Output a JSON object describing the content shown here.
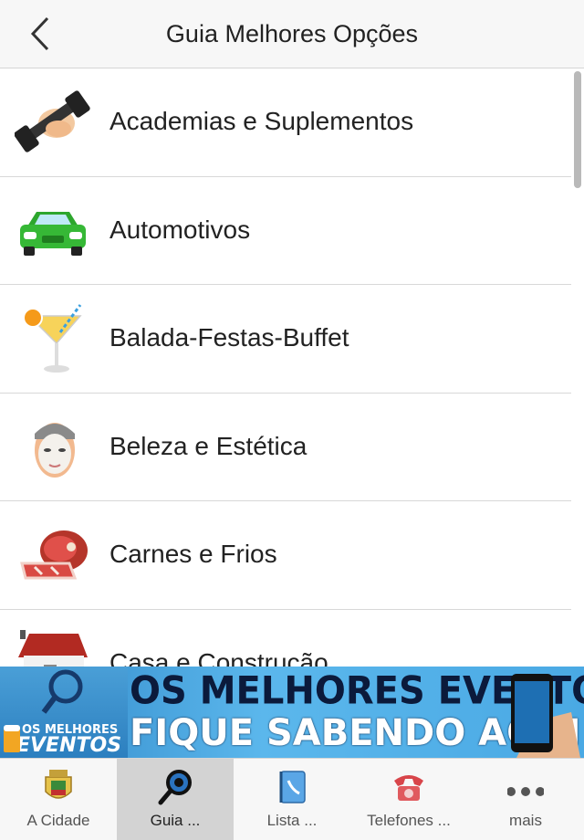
{
  "header": {
    "title": "Guia Melhores Opções",
    "back_icon": "chevron-left-icon"
  },
  "list": {
    "items": [
      {
        "label": "Academias e Suplementos",
        "icon": "dumbbell-icon"
      },
      {
        "label": "Automotivos",
        "icon": "car-icon"
      },
      {
        "label": "Balada-Festas-Buffet",
        "icon": "cocktail-icon"
      },
      {
        "label": "Beleza e Estética",
        "icon": "face-mask-icon"
      },
      {
        "label": "Carnes e Frios",
        "icon": "meat-icon"
      },
      {
        "label": "Casa e Construção",
        "icon": "house-icon"
      }
    ]
  },
  "banner": {
    "line1": "OS MELHORES EVENTOS",
    "line2": "FIQUE SABENDO AQUI",
    "badge_small": "OS MELHORES",
    "badge_big": "EVENTOS"
  },
  "tabbar": {
    "tabs": [
      {
        "label": "A Cidade",
        "icon": "city-crest-icon"
      },
      {
        "label": "Guia ...",
        "icon": "magnifier-icon"
      },
      {
        "label": "Lista ...",
        "icon": "contacts-book-icon"
      },
      {
        "label": "Telefones ...",
        "icon": "telephone-icon"
      },
      {
        "label": "mais",
        "icon": "more-icon"
      }
    ],
    "active_index": 1
  },
  "colors": {
    "accent": "#2f86c7",
    "header_bg": "#f7f7f7",
    "active_tab_bg": "#d3d3d3"
  }
}
